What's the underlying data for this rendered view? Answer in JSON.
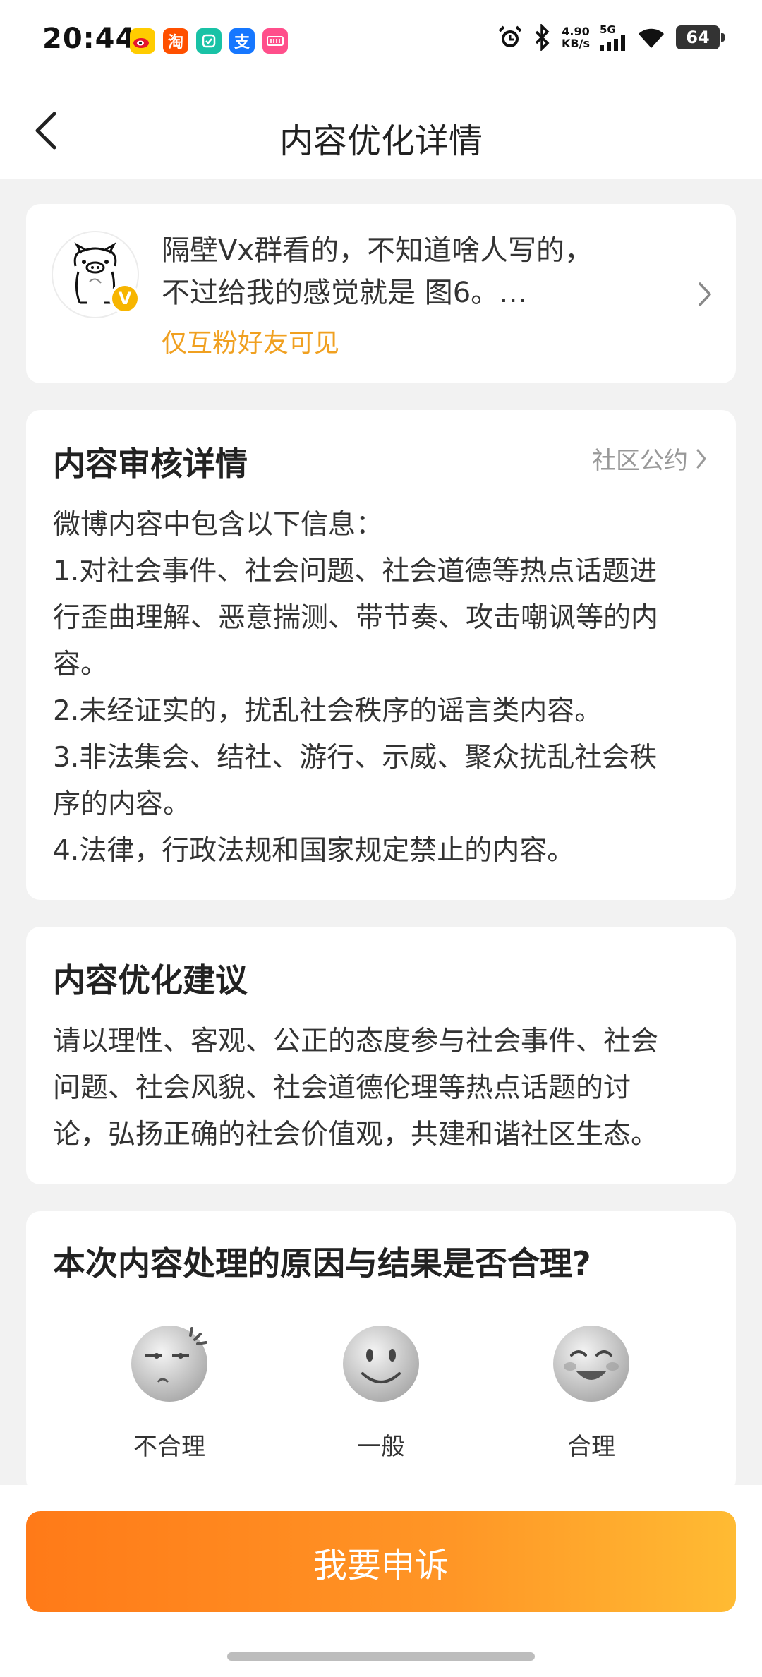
{
  "status": {
    "time": "20:44",
    "speed_value": "4.90",
    "speed_unit": "KB/s",
    "network": "5G",
    "battery": "64"
  },
  "nav": {
    "title": "内容优化详情"
  },
  "post": {
    "text_line1": "隔壁Vx群看的，不知道啥人写的，",
    "text_line2": "不过给我的感觉就是 图6。…",
    "visibility": "仅互粉好友可见",
    "badge": "V"
  },
  "review": {
    "title": "内容审核详情",
    "rules_link": "社区公约",
    "lines": [
      "微博内容中包含以下信息：",
      "1.对社会事件、社会问题、社会道德等热点话题进",
      "行歪曲理解、恶意揣测、带节奏、攻击嘲讽等的内",
      "容。",
      "2.未经证实的，扰乱社会秩序的谣言类内容。",
      "3.非法集会、结社、游行、示威、聚众扰乱社会秩",
      "序的内容。",
      "4.法律，行政法规和国家规定禁止的内容。"
    ]
  },
  "suggest": {
    "title": "内容优化建议",
    "lines": [
      "请以理性、客观、公正的态度参与社会事件、社会",
      "问题、社会风貌、社会道德伦理等热点话题的讨",
      "论，弘扬正确的社会价值观，共建和谐社区生态。"
    ]
  },
  "feedback": {
    "question": "本次内容处理的原因与结果是否合理?",
    "options": [
      {
        "label": "不合理",
        "icon": "angry-face-icon"
      },
      {
        "label": "一般",
        "icon": "neutral-face-icon"
      },
      {
        "label": "合理",
        "icon": "happy-face-icon"
      }
    ]
  },
  "appeal_button": "我要申诉",
  "colors": {
    "accent_orange": "#ff8a1f",
    "visibility_text": "#f0a020",
    "badge": "#f7b500",
    "background": "#f2f2f2"
  }
}
